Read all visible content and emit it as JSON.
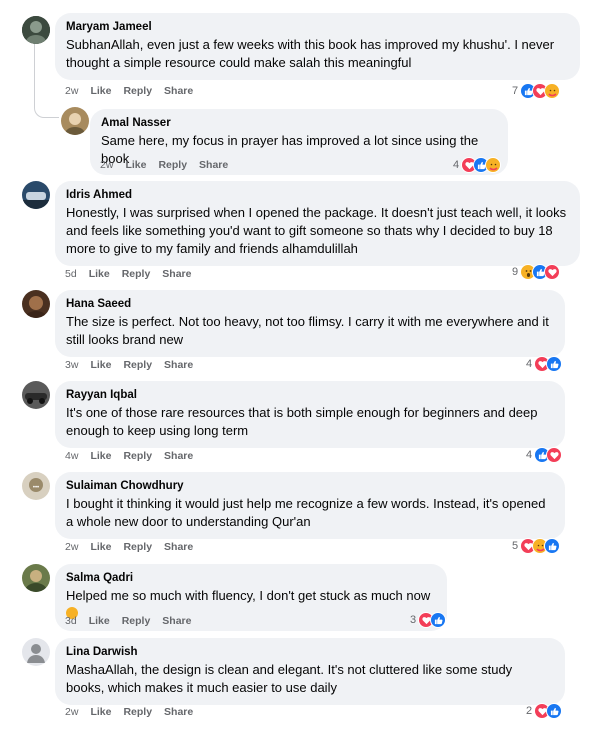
{
  "comments": [
    {
      "name": "Maryam Jameel",
      "text": "SubhanAllah, even just a few weeks with this book has improved my khushu'. I never thought a simple resource could make salah this meaningful",
      "time": "2w",
      "count": "7",
      "reactions": [
        "like",
        "love",
        "care"
      ]
    },
    {
      "name": "Amal Nasser",
      "text": "Same here, my focus in prayer has improved a lot since using the book",
      "time": "2w",
      "count": "4",
      "reactions": [
        "love",
        "like",
        "care"
      ]
    },
    {
      "name": "Idris Ahmed",
      "text": "Honestly, I was surprised when I opened the package. It doesn't just teach well, it looks and feels like something you'd want to gift someone so thats why I decided to buy 18 more to give to my family and friends alhamdulillah",
      "time": "5d",
      "count": "9",
      "reactions": [
        "wow",
        "like",
        "love"
      ]
    },
    {
      "name": "Hana Saeed",
      "text": "The size is perfect. Not too heavy, not too flimsy. I carry it with me everywhere and it still looks brand new",
      "time": "3w",
      "count": "4",
      "reactions": [
        "love",
        "like"
      ]
    },
    {
      "name": "Rayyan Iqbal",
      "text": "It's one of those rare resources that is both simple enough for beginners and deep enough to keep using long term",
      "time": "4w",
      "count": "4",
      "reactions": [
        "like",
        "love"
      ]
    },
    {
      "name": "Sulaiman Chowdhury",
      "text": "I bought it thinking it would just help me recognize a few words. Instead, it's opened a whole new door to understanding Qur'an",
      "time": "2w",
      "count": "5",
      "reactions": [
        "love",
        "care",
        "like"
      ]
    },
    {
      "name": "Salma Qadri",
      "text": "Helped me so much with fluency, I don't get stuck as much now",
      "time": "3d",
      "count": "3",
      "reactions": [
        "love",
        "like"
      ]
    },
    {
      "name": "Lina Darwish",
      "text": "MashaAllah, the design is clean and elegant. It's not cluttered like some study books, which makes it much easier to use daily",
      "time": "2w",
      "count": "2",
      "reactions": [
        "love",
        "like"
      ]
    }
  ],
  "actions": {
    "like": "Like",
    "reply": "Reply",
    "share": "Share"
  },
  "colors": {
    "bubble": "#f0f2f5",
    "like": "#1877f2",
    "love": "#f33e58",
    "care": "#f7b125",
    "meta": "#65676b"
  }
}
